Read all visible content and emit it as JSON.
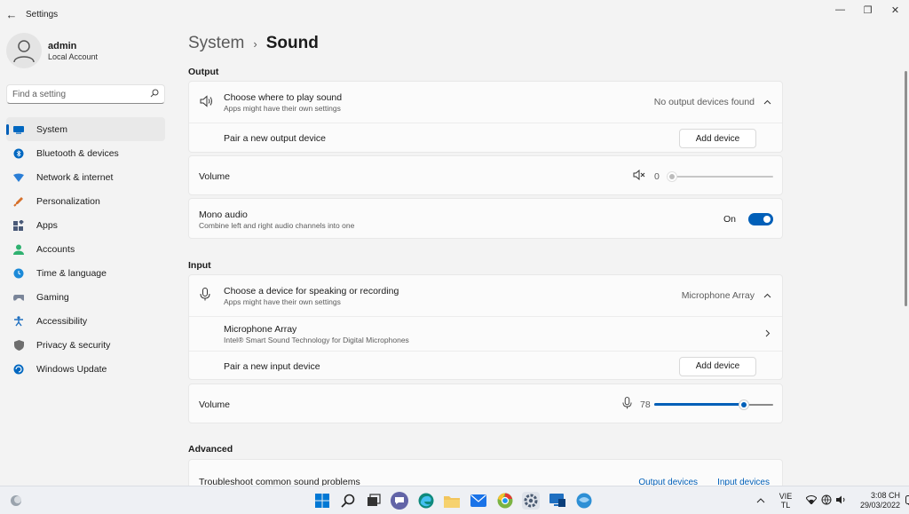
{
  "window": {
    "title": "Settings",
    "back": "←",
    "minimize": "—",
    "maximize": "❐",
    "close": "✕"
  },
  "profile": {
    "name": "admin",
    "account_type": "Local Account"
  },
  "search": {
    "placeholder": "Find a setting"
  },
  "nav": [
    {
      "label": "System",
      "icon": "system-icon",
      "active": true
    },
    {
      "label": "Bluetooth & devices",
      "icon": "bluetooth-icon"
    },
    {
      "label": "Network & internet",
      "icon": "network-icon"
    },
    {
      "label": "Personalization",
      "icon": "personalization-icon"
    },
    {
      "label": "Apps",
      "icon": "apps-icon"
    },
    {
      "label": "Accounts",
      "icon": "accounts-icon"
    },
    {
      "label": "Time & language",
      "icon": "time-language-icon"
    },
    {
      "label": "Gaming",
      "icon": "gaming-icon"
    },
    {
      "label": "Accessibility",
      "icon": "accessibility-icon"
    },
    {
      "label": "Privacy & security",
      "icon": "privacy-icon"
    },
    {
      "label": "Windows Update",
      "icon": "windows-update-icon"
    }
  ],
  "breadcrumb": {
    "parent": "System",
    "separator": "›",
    "current": "Sound"
  },
  "output": {
    "heading": "Output",
    "choose_title": "Choose where to play sound",
    "choose_subtitle": "Apps might have their own settings",
    "choose_status": "No output devices found",
    "pair_label": "Pair a new output device",
    "add_button": "Add device",
    "volume_label": "Volume",
    "volume_value": "0",
    "volume_level": 0,
    "mono_title": "Mono audio",
    "mono_subtitle": "Combine left and right audio channels into one",
    "mono_state": "On"
  },
  "input": {
    "heading": "Input",
    "choose_title": "Choose a device for speaking or recording",
    "choose_subtitle": "Apps might have their own settings",
    "choose_status": "Microphone Array",
    "device_title": "Microphone Array",
    "device_subtitle": "Intel® Smart Sound Technology for Digital Microphones",
    "pair_label": "Pair a new input device",
    "add_button": "Add device",
    "volume_label": "Volume",
    "volume_value": "78",
    "volume_level": 78
  },
  "advanced": {
    "heading": "Advanced",
    "troubleshoot_label": "Troubleshoot common sound problems",
    "output_link": "Output devices",
    "input_link": "Input devices"
  },
  "taskbar": {
    "lang_line1": "VIE",
    "lang_line2": "TL",
    "time": "3:08 CH",
    "date": "29/03/2022"
  },
  "colors": {
    "accent": "#005fb8"
  }
}
